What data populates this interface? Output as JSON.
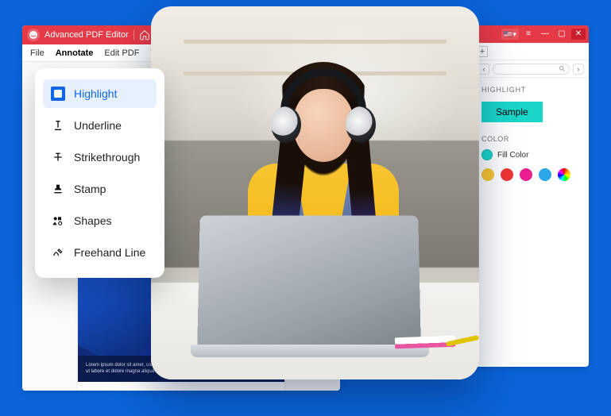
{
  "app": {
    "title": "Advanced PDF Editor"
  },
  "menu": {
    "file": "File",
    "annotate": "Annotate",
    "edit_pdf": "Edit PDF",
    "views": "Views"
  },
  "annotate_dropdown": {
    "items": [
      {
        "label": "Highlight",
        "selected": true
      },
      {
        "label": "Underline"
      },
      {
        "label": "Strikethrough"
      },
      {
        "label": "Stamp"
      },
      {
        "label": "Shapes"
      },
      {
        "label": "Freehand Line"
      }
    ]
  },
  "document": {
    "lorem": "Lorem ipsum dolor sit amet, consectetur adipiscing elit, sed do eiusmod tempor incididunt ut labore et dolore magna aliqua ut enim ad minim"
  },
  "side_panel": {
    "section_label": "HIGHLIGHT",
    "sample_text": "Sample",
    "color_label": "COLOR",
    "fill_label": "Fill Color",
    "palette": [
      "#f7c531",
      "#ef3434",
      "#ec1e90",
      "#2aa7e8",
      "rainbow"
    ]
  }
}
